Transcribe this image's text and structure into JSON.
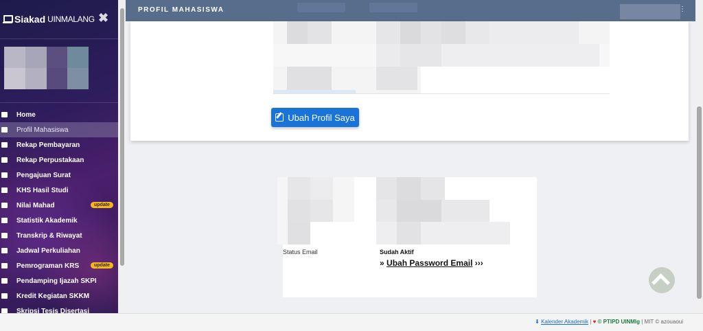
{
  "brand": {
    "name_bold": "Siakad",
    "name_light": "UINMALANG"
  },
  "sidebar": {
    "close_symbol": "✖",
    "items": [
      {
        "label": "Home",
        "icon": "home-icon"
      },
      {
        "label": "Profil Mahasiswa",
        "icon": "id-card-icon",
        "active": true
      },
      {
        "label": "Rekap Pembayaran",
        "icon": "money-icon"
      },
      {
        "label": "Rekap Perpustakaan",
        "icon": "book-icon"
      },
      {
        "label": "Pengajuan Surat",
        "icon": "envelope-icon"
      },
      {
        "label": "KHS Hasil Studi",
        "icon": "inbox-icon"
      },
      {
        "label": "Nilai Mahad",
        "icon": "building-icon",
        "badge": "update"
      },
      {
        "label": "Statistik Akademik",
        "icon": "chart-icon"
      },
      {
        "label": "Transkrip & Riwayat",
        "icon": "copy-icon"
      },
      {
        "label": "Jadwal Perkuliahan",
        "icon": "calendar-icon"
      },
      {
        "label": "Pemrograman KRS",
        "icon": "calendar-plus-icon",
        "badge": "update"
      },
      {
        "label": "Pendamping Ijazah SKPI",
        "icon": "file-icon"
      },
      {
        "label": "Kredit Kegiatan SKKM",
        "icon": "compass-icon"
      },
      {
        "label": "Skripsi Tesis Disertasi",
        "icon": "file-text-icon"
      }
    ]
  },
  "header": {
    "title": "PROFIL MAHASISWA",
    "menu_dots": "⋮"
  },
  "profile_card": {
    "edit_button": "Ubah Profil Saya"
  },
  "email_card": {
    "status_label": "Status Email",
    "status_value": "Sudah Aktif",
    "prefix": "»",
    "link_text": "Ubah Password Email",
    "suffix": "›››"
  },
  "footer": {
    "calendar_link": "Kalender Akademik",
    "separator": "|",
    "credit": "© PTIPD UINMlg",
    "license": "MIT © azouaoui"
  },
  "colors": {
    "accent": "#1a73d9",
    "header": "#586c8c",
    "badge": "#f5b81b"
  }
}
